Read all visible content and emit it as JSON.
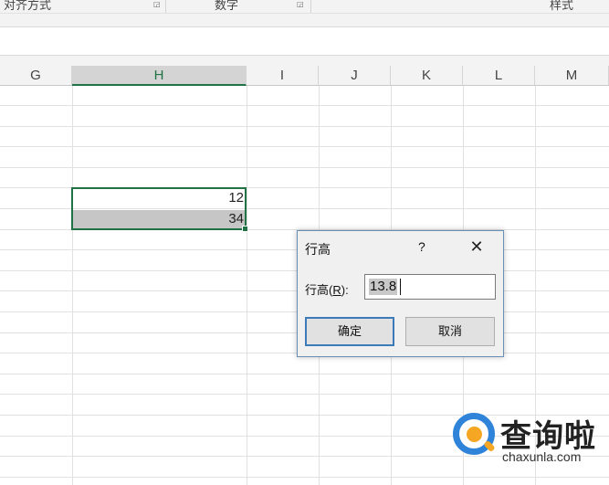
{
  "ribbon": {
    "groups": [
      "对齐方式",
      "数字",
      "样式"
    ]
  },
  "sheet": {
    "columns": [
      "G",
      "H",
      "I",
      "J",
      "K",
      "L",
      "M"
    ],
    "selected_column": "H",
    "cells": [
      {
        "ref": "H6",
        "value": "12"
      },
      {
        "ref": "H7",
        "value": "34"
      }
    ]
  },
  "dialog": {
    "title": "行高",
    "help": "?",
    "close": "✕",
    "field_label_prefix": "行高(",
    "field_label_mnemonic": "R",
    "field_label_suffix": "):",
    "field_value": "13.8",
    "ok_label": "确定",
    "cancel_label": "取消"
  },
  "watermark": {
    "name": "查询啦",
    "url": "chaxunla.com",
    "colors": {
      "ring": "#2f83d8",
      "dot": "#f5a623"
    }
  },
  "colors": {
    "accent": "#217346",
    "dialog_border": "#6a8fb5",
    "ok_border": "#3d7ab8"
  }
}
